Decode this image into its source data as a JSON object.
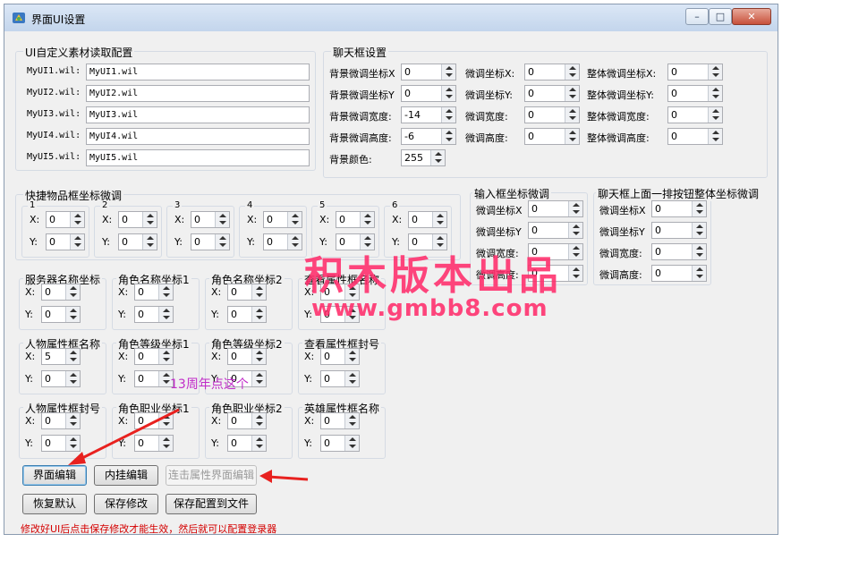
{
  "window": {
    "title": "界面UI设置",
    "controls": {
      "minimize": "–",
      "maximize": "□",
      "close": "✕"
    }
  },
  "ui_materials": {
    "title": "UI自定义素材读取配置",
    "rows": [
      {
        "label": "MyUI1.wil:",
        "value": "MyUI1.wil"
      },
      {
        "label": "MyUI2.wil:",
        "value": "MyUI2.wil"
      },
      {
        "label": "MyUI3.wil:",
        "value": "MyUI3.wil"
      },
      {
        "label": "MyUI4.wil:",
        "value": "MyUI4.wil"
      },
      {
        "label": "MyUI5.wil:",
        "value": "MyUI5.wil"
      }
    ]
  },
  "chat_settings": {
    "title": "聊天框设置",
    "col1": [
      {
        "label": "背景微调坐标X",
        "value": "0"
      },
      {
        "label": "背景微调坐标Y",
        "value": "0"
      },
      {
        "label": "背景微调宽度:",
        "value": "-14"
      },
      {
        "label": "背景微调高度:",
        "value": "-6"
      }
    ],
    "col2": [
      {
        "label": "微调坐标X:",
        "value": "0"
      },
      {
        "label": "微调坐标Y:",
        "value": "0"
      },
      {
        "label": "微调宽度:",
        "value": "0"
      },
      {
        "label": "微调高度:",
        "value": "0"
      }
    ],
    "col3": [
      {
        "label": "整体微调坐标X:",
        "value": "0"
      },
      {
        "label": "整体微调坐标Y:",
        "value": "0"
      },
      {
        "label": "整体微调宽度:",
        "value": "0"
      },
      {
        "label": "整体微调高度:",
        "value": "0"
      }
    ],
    "bg_color": {
      "label": "背景颜色:",
      "value": "255"
    }
  },
  "quick_items": {
    "title": "快捷物品框坐标微调",
    "slots": [
      {
        "name": "1",
        "x": "0",
        "y": "0"
      },
      {
        "name": "2",
        "x": "0",
        "y": "0"
      },
      {
        "name": "3",
        "x": "0",
        "y": "0"
      },
      {
        "name": "4",
        "x": "0",
        "y": "0"
      },
      {
        "name": "5",
        "x": "0",
        "y": "0"
      },
      {
        "name": "6",
        "x": "0",
        "y": "0"
      }
    ],
    "x_label": "X:",
    "y_label": "Y:"
  },
  "input_box": {
    "title": "输入框坐标微调",
    "rows": [
      {
        "label": "微调坐标X",
        "value": "0"
      },
      {
        "label": "微调坐标Y",
        "value": "0"
      },
      {
        "label": "微调宽度:",
        "value": "0"
      },
      {
        "label": "微调高度:",
        "value": "0"
      }
    ]
  },
  "chat_top_buttons": {
    "title": "聊天框上面一排按钮整体坐标微调",
    "rows": [
      {
        "label": "微调坐标X",
        "value": "0"
      },
      {
        "label": "微调坐标Y",
        "value": "0"
      },
      {
        "label": "微调宽度:",
        "value": "0"
      },
      {
        "label": "微调高度:",
        "value": "0"
      }
    ]
  },
  "coord_boxes": [
    {
      "title": "服务器名称坐标",
      "x": "0",
      "y": "0"
    },
    {
      "title": "角色名称坐标1",
      "x": "0",
      "y": "0"
    },
    {
      "title": "角色名称坐标2",
      "x": "0",
      "y": "0"
    },
    {
      "title": "查看属性框名称",
      "x": "0",
      "y": "0"
    },
    {
      "title": "人物属性框名称",
      "x": "5",
      "y": "0"
    },
    {
      "title": "角色等级坐标1",
      "x": "0",
      "y": "0"
    },
    {
      "title": "角色等级坐标2",
      "x": "0",
      "y": "0"
    },
    {
      "title": "查看属性框封号",
      "x": "0",
      "y": "0"
    },
    {
      "title": "人物属性框封号",
      "x": "0",
      "y": "0"
    },
    {
      "title": "角色职业坐标1",
      "x": "0",
      "y": "0"
    },
    {
      "title": "角色职业坐标2",
      "x": "0",
      "y": "0"
    },
    {
      "title": "英雄属性框名称",
      "x": "0",
      "y": "0"
    }
  ],
  "buttons": {
    "ui_edit": "界面编辑",
    "plugin_edit": "内挂编辑",
    "attr_edit": "连击属性界面编辑",
    "restore": "恢复默认",
    "save": "保存修改",
    "save_file": "保存配置到文件"
  },
  "note": "修改好UI后点击保存修改才能生效，然后就可以配置登录器",
  "watermark": {
    "line1": "积木版本出品",
    "line2": "www.gmbb8.com"
  },
  "annotation": "13周年点这个",
  "colors": {
    "note": "#d40000",
    "watermark": "#ff2d6b",
    "annotation": "#c02cc8",
    "arrow": "#e8211f"
  }
}
